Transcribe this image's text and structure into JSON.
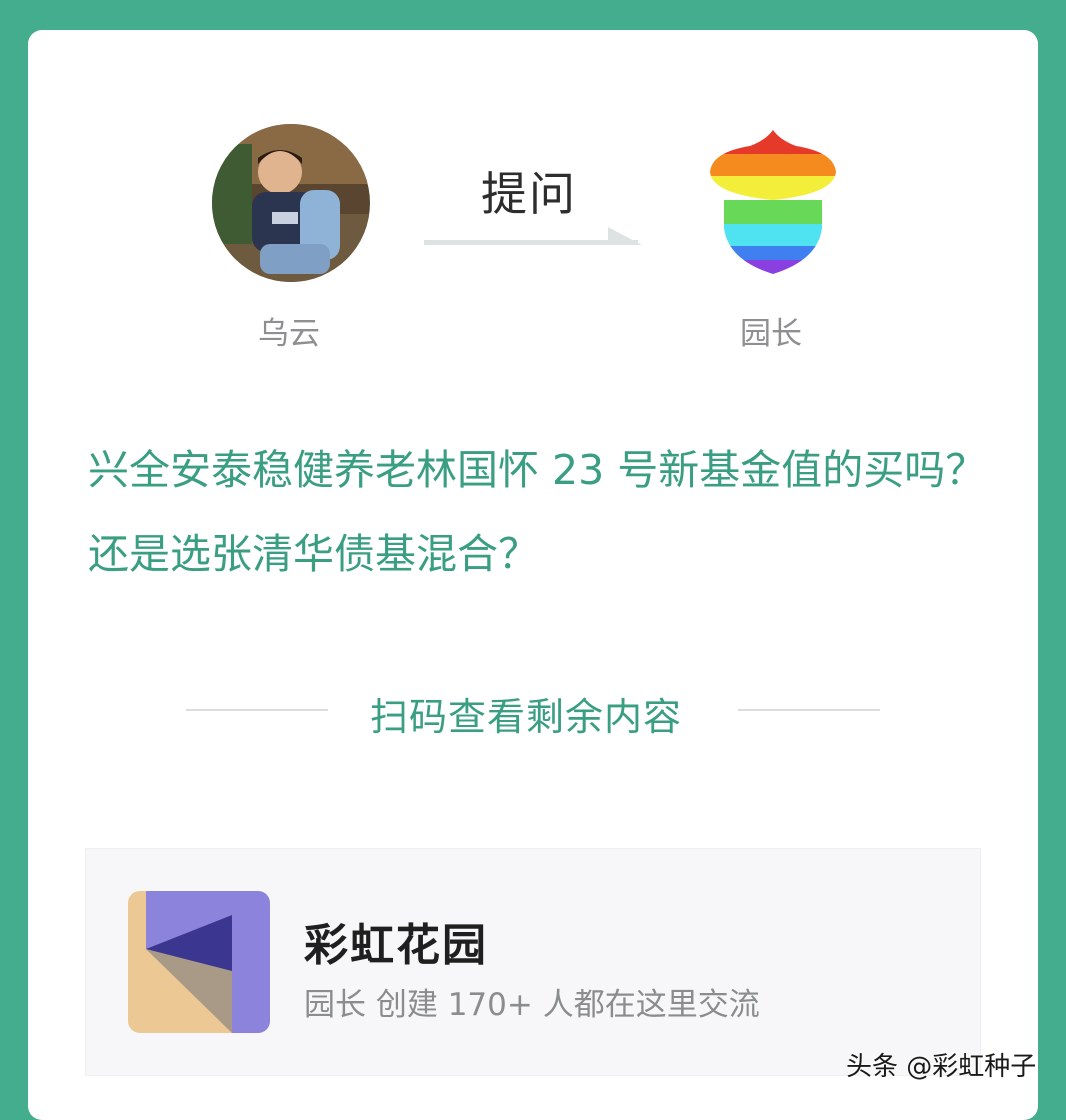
{
  "asker": {
    "name": "乌云"
  },
  "action": {
    "label": "提问"
  },
  "host": {
    "name": "园长"
  },
  "question": {
    "text": "兴全安泰稳健养老林国怀 23 号新基金值的买吗？还是选张清华债基混合？"
  },
  "scan_prompt": "扫码查看剩余内容",
  "community": {
    "title": "彩虹花园",
    "meta": "园长 创建  170+ 人都在这里交流"
  },
  "watermark": "头条 @彩虹种子",
  "colors": {
    "background": "#44ad8e",
    "accent_text": "#3a9e82",
    "card": "#ffffff"
  }
}
